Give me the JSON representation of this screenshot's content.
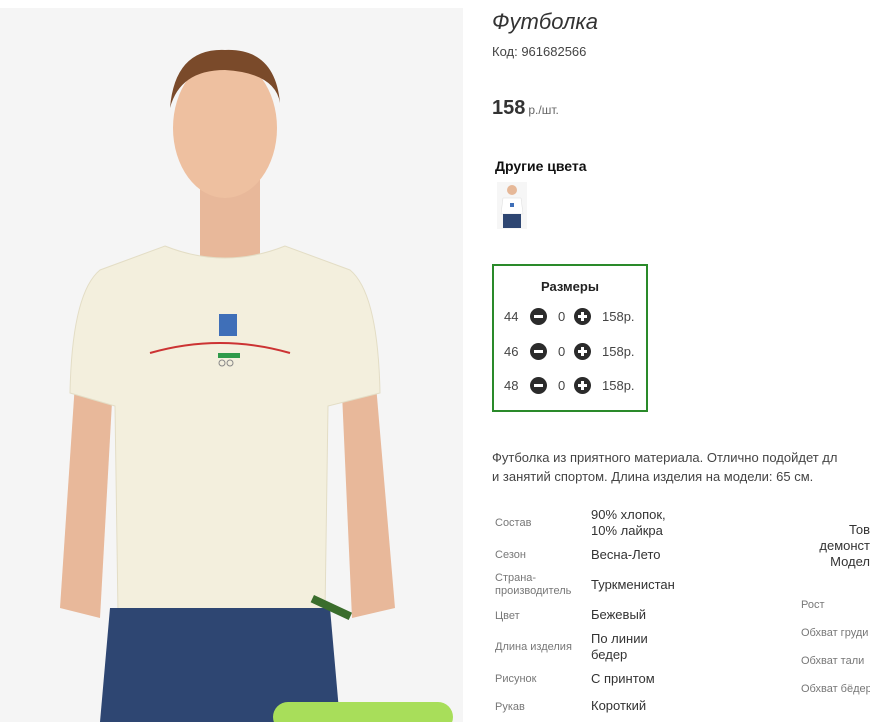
{
  "product": {
    "title": "Футболка",
    "code": "Код: 961682566",
    "price": "158",
    "price_unit": "р./шт."
  },
  "colors": {
    "title": "Другие цвета",
    "thumb_icon": "tshirt-thumbnail-image"
  },
  "sizes": {
    "title": "Размеры",
    "rows": [
      {
        "size": "44",
        "qty": "0",
        "price": "158р."
      },
      {
        "size": "46",
        "qty": "0",
        "price": "158р."
      },
      {
        "size": "48",
        "qty": "0",
        "price": "158р."
      }
    ]
  },
  "description": {
    "line1": "Футболка из приятного материала. Отлично подойдет дл",
    "line2": "и занятий спортом. Длина изделия на модели: 65 см."
  },
  "specs": [
    {
      "label": "Состав",
      "value": [
        "90% хлопок,",
        "10% лайкра"
      ]
    },
    {
      "label": "Сезон",
      "value": [
        "Весна-Лето"
      ]
    },
    {
      "label": "Страна-производитель",
      "value": [
        "Туркменистан"
      ]
    },
    {
      "label": "Цвет",
      "value": [
        "Бежевый"
      ]
    },
    {
      "label": "Длина изделия",
      "value": [
        "По линии",
        "бедер"
      ]
    },
    {
      "label": "Рисунок",
      "value": [
        "С принтом"
      ]
    },
    {
      "label": "Рукав",
      "value": [
        "Короткий"
      ]
    }
  ],
  "model": {
    "title_lines": [
      "Тов",
      "демонст",
      "Модел"
    ],
    "labels": [
      "Рост",
      "Обхват груди",
      "Обхват тали",
      "Обхват бёдер"
    ]
  },
  "colors_palette": {
    "accent_border": "#2a8a2a",
    "cart_button": "#a8de5a"
  }
}
